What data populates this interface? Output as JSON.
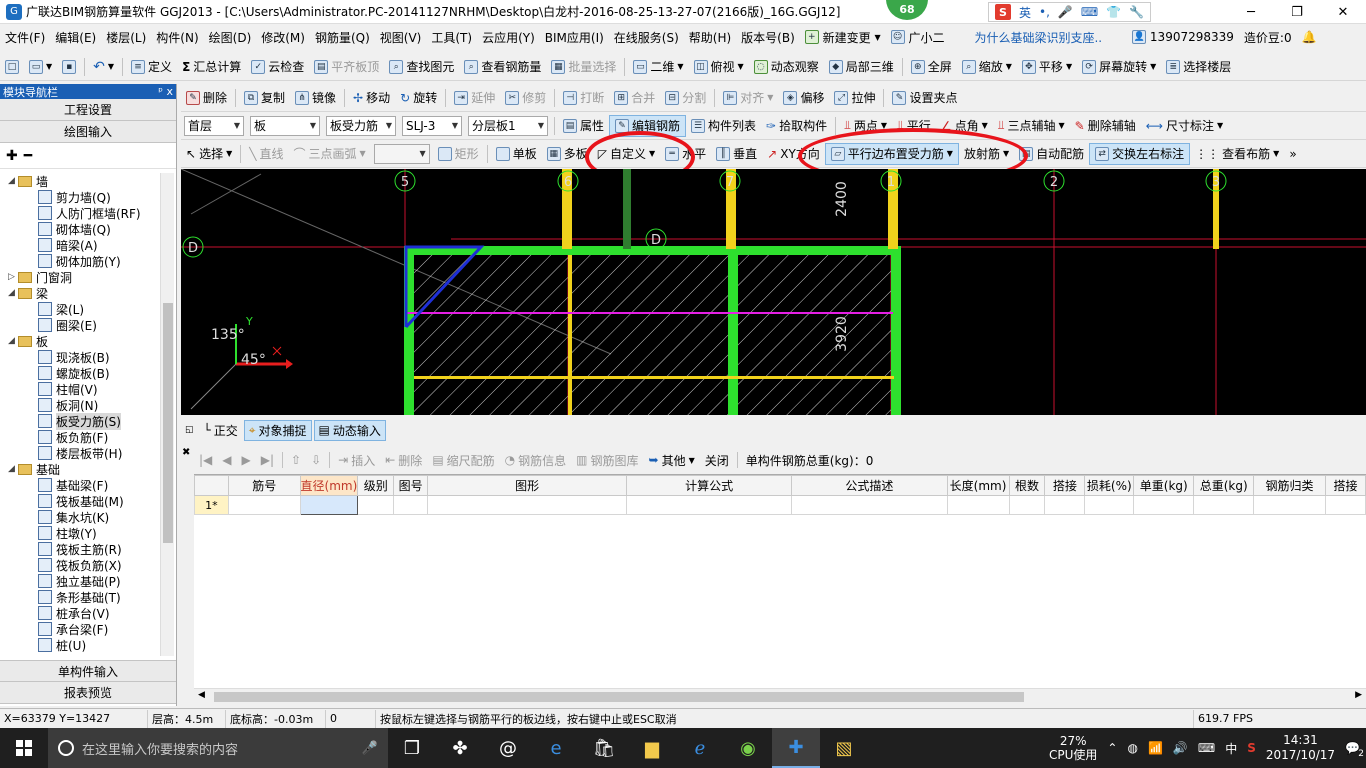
{
  "window": {
    "title": "广联达BIM钢筋算量软件 GGJ2013 - [C:\\Users\\Administrator.PC-20141127NRHM\\Desktop\\白龙村-2016-08-25-13-27-07(2166版)_16G.GGJ12]",
    "badge": "68",
    "ime_label": "英"
  },
  "menubar": {
    "items": [
      "文件(F)",
      "编辑(E)",
      "楼层(L)",
      "构件(N)",
      "绘图(D)",
      "修改(M)",
      "钢筋量(Q)",
      "视图(V)",
      "工具(T)",
      "云应用(Y)",
      "BIM应用(I)",
      "在线服务(S)",
      "帮助(H)",
      "版本号(B)"
    ],
    "new_change": "新建变更",
    "assistant": "广小二",
    "news_link": "为什么基础梁识别支座..",
    "phone": "13907298339",
    "cost_points": "造价豆:0"
  },
  "toolbar1": {
    "define": "定义",
    "sum_calc": "汇总计算",
    "cloud_check": "云检查",
    "align_top": "平齐板顶",
    "find": "查找图元",
    "view_rebar": "查看钢筋量",
    "batch_select": "批量选择",
    "view2d": "二维",
    "topview": "俯视",
    "dynamic": "动态观察",
    "local3d": "局部三维",
    "fullscreen": "全屏",
    "zoom": "缩放",
    "pan": "平移",
    "rotate_screen": "屏幕旋转",
    "select_floor": "选择楼层"
  },
  "toolbar2": {
    "delete": "删除",
    "copy": "复制",
    "mirror": "镜像",
    "move": "移动",
    "rotate": "旋转",
    "extend": "延伸",
    "trim": "修剪",
    "break": "打断",
    "merge": "合并",
    "split": "分割",
    "align": "对齐",
    "offset": "偏移",
    "stretch": "拉伸",
    "set_point": "设置夹点"
  },
  "toolbar3": {
    "floor": "首层",
    "type": "板",
    "subtype": "板受力筋",
    "item": "SLJ-3",
    "layer": "分层板1",
    "props": "属性",
    "edit_rebar": "编辑钢筋",
    "component_list": "构件列表",
    "pick": "拾取构件",
    "two_points": "两点",
    "parallel": "平行",
    "point_angle": "点角",
    "three_points": "三点辅轴",
    "delete_aux": "删除辅轴",
    "dimension": "尺寸标注"
  },
  "toolbar4": {
    "select": "选择",
    "line": "直线",
    "arc": "三点画弧",
    "rect": "矩形",
    "single": "单板",
    "multi": "多板",
    "custom": "自定义",
    "horizontal": "水平",
    "vertical": "垂直",
    "xy_dir": "XY方向",
    "parallel_edge": "平行边布置受力筋",
    "radial": "放射筋",
    "auto_rebar": "自动配筋",
    "swap_labels": "交换左右标注",
    "view_layout": "查看布筋"
  },
  "left_panel": {
    "header": "模块导航栏",
    "pin": "ᵖ x",
    "btn_project": "工程设置",
    "btn_drawing": "绘图输入",
    "tree": [
      {
        "level": 0,
        "toggle": "▢",
        "label": "墙",
        "icon": "folder"
      },
      {
        "level": 1,
        "label": "剪力墙(Q)",
        "icon": "shear-wall"
      },
      {
        "level": 1,
        "label": "人防门框墙(RF)",
        "icon": "door-frame-wall"
      },
      {
        "level": 1,
        "label": "砌体墙(Q)",
        "icon": "masonry-wall"
      },
      {
        "level": 1,
        "label": "暗梁(A)",
        "icon": "hidden-beam"
      },
      {
        "level": 1,
        "label": "砌体加筋(Y)",
        "icon": "masonry-rebar"
      },
      {
        "level": 0,
        "toggle": "▷",
        "label": "门窗洞",
        "icon": "folder"
      },
      {
        "level": 0,
        "toggle": "▢",
        "label": "梁",
        "icon": "folder"
      },
      {
        "level": 1,
        "label": "梁(L)",
        "icon": "beam"
      },
      {
        "level": 1,
        "label": "圈梁(E)",
        "icon": "ring-beam"
      },
      {
        "level": 0,
        "toggle": "▢",
        "label": "板",
        "icon": "folder"
      },
      {
        "level": 1,
        "label": "现浇板(B)",
        "icon": "cast-slab"
      },
      {
        "level": 1,
        "label": "螺旋板(B)",
        "icon": "spiral-slab"
      },
      {
        "level": 1,
        "label": "柱帽(V)",
        "icon": "column-cap"
      },
      {
        "level": 1,
        "label": "板洞(N)",
        "icon": "slab-hole"
      },
      {
        "level": 1,
        "label": "板受力筋(S)",
        "icon": "slab-rebar",
        "selected": true
      },
      {
        "level": 1,
        "label": "板负筋(F)",
        "icon": "negative-rebar"
      },
      {
        "level": 1,
        "label": "楼层板带(H)",
        "icon": "floor-strip"
      },
      {
        "level": 0,
        "toggle": "▢",
        "label": "基础",
        "icon": "folder"
      },
      {
        "level": 1,
        "label": "基础梁(F)",
        "icon": "foundation-beam"
      },
      {
        "level": 1,
        "label": "筏板基础(M)",
        "icon": "raft-foundation"
      },
      {
        "level": 1,
        "label": "集水坑(K)",
        "icon": "sump"
      },
      {
        "level": 1,
        "label": "柱墩(Y)",
        "icon": "column-pier"
      },
      {
        "level": 1,
        "label": "筏板主筋(R)",
        "icon": "raft-main-rebar"
      },
      {
        "level": 1,
        "label": "筏板负筋(X)",
        "icon": "raft-neg-rebar"
      },
      {
        "level": 1,
        "label": "独立基础(P)",
        "icon": "isolated-footing"
      },
      {
        "level": 1,
        "label": "条形基础(T)",
        "icon": "strip-footing"
      },
      {
        "level": 1,
        "label": "桩承台(V)",
        "icon": "pile-cap"
      },
      {
        "level": 1,
        "label": "承台梁(F)",
        "icon": "cap-beam"
      },
      {
        "level": 1,
        "label": "桩(U)",
        "icon": "pile"
      }
    ],
    "btn_single": "单构件输入",
    "btn_report": "报表预览"
  },
  "canvas": {
    "axis_labels": [
      "5",
      "6",
      "7",
      "1",
      "2",
      "3",
      "D",
      "D"
    ],
    "dim_top": "2400",
    "dim_side": "3920",
    "angle1": "135°",
    "angle2": "45°"
  },
  "bottom_tabs": {
    "ortho": "正交",
    "snap": "对象捕捉",
    "dyn_input": "动态输入"
  },
  "grid_toolbar": {
    "insert": "插入",
    "delete": "删除",
    "scale_rebar": "缩尺配筋",
    "rebar_info": "钢筋信息",
    "rebar_lib": "钢筋图库",
    "other": "其他",
    "close": "关闭",
    "total_weight": "单构件钢筋总重(kg)：0"
  },
  "table": {
    "columns": [
      "筋号",
      "直径(mm)",
      "级别",
      "图号",
      "图形",
      "计算公式",
      "公式描述",
      "长度(mm)",
      "根数",
      "搭接",
      "损耗(%)",
      "单重(kg)",
      "总重(kg)",
      "钢筋归类",
      "搭接"
    ],
    "rows": [
      [
        "1*"
      ]
    ]
  },
  "status": {
    "coords": "X=63379 Y=13427",
    "floor_height": "层高：4.5m",
    "base_height": "底标高：-0.03m",
    "count": "0",
    "hint": "按鼠标左键选择与钢筋平行的板边线，按右键中止或ESC取消",
    "fps": "619.7 FPS"
  },
  "taskbar": {
    "search_placeholder": "在这里输入你要搜索的内容",
    "cpu_percent": "27%",
    "cpu_label": "CPU使用",
    "lang": "中",
    "time": "14:31",
    "date": "2017/10/17",
    "notifications": "2"
  }
}
